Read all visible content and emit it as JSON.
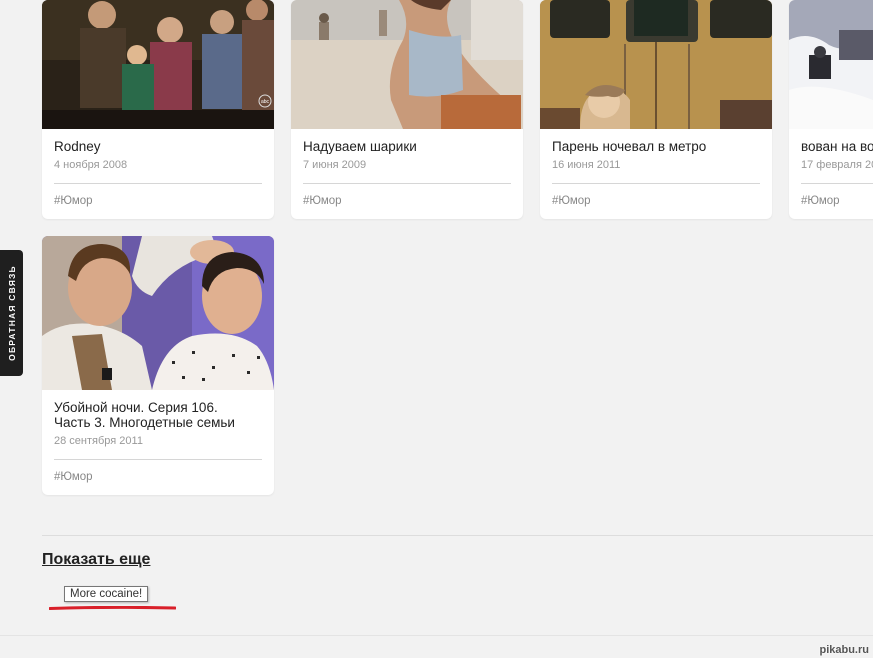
{
  "cards": [
    {
      "title": "Rodney",
      "date": "4 ноября 2008",
      "tag": "#Юмор"
    },
    {
      "title": "Надуваем шарики",
      "date": "7 июня 2009",
      "tag": "#Юмор"
    },
    {
      "title": "Парень ночевал в метро",
      "date": "16 июня 2011",
      "tag": "#Юмор"
    },
    {
      "title": "вован на во",
      "date": "17 февраля 20",
      "tag": "#Юмор"
    },
    {
      "title": "Убойной ночи. Серия 106.\nЧасть 3. Многодетные семьи",
      "date": "28 сентября 2011",
      "tag": "#Юмор"
    }
  ],
  "feedback_tab": {
    "label": "ОБРАТНАЯ СВЯЗЬ"
  },
  "show_more": {
    "label": "Показать еще"
  },
  "tooltip": {
    "text": "More cocaine!"
  },
  "watermark": {
    "text": "pikabu.ru"
  },
  "thumbnail_1_logo": {
    "text": "abc"
  },
  "colors": {
    "background": "#f2f2f2",
    "card": "#ffffff",
    "accent_red": "#d9202a",
    "feedback_tab": "#1f1f1f"
  }
}
